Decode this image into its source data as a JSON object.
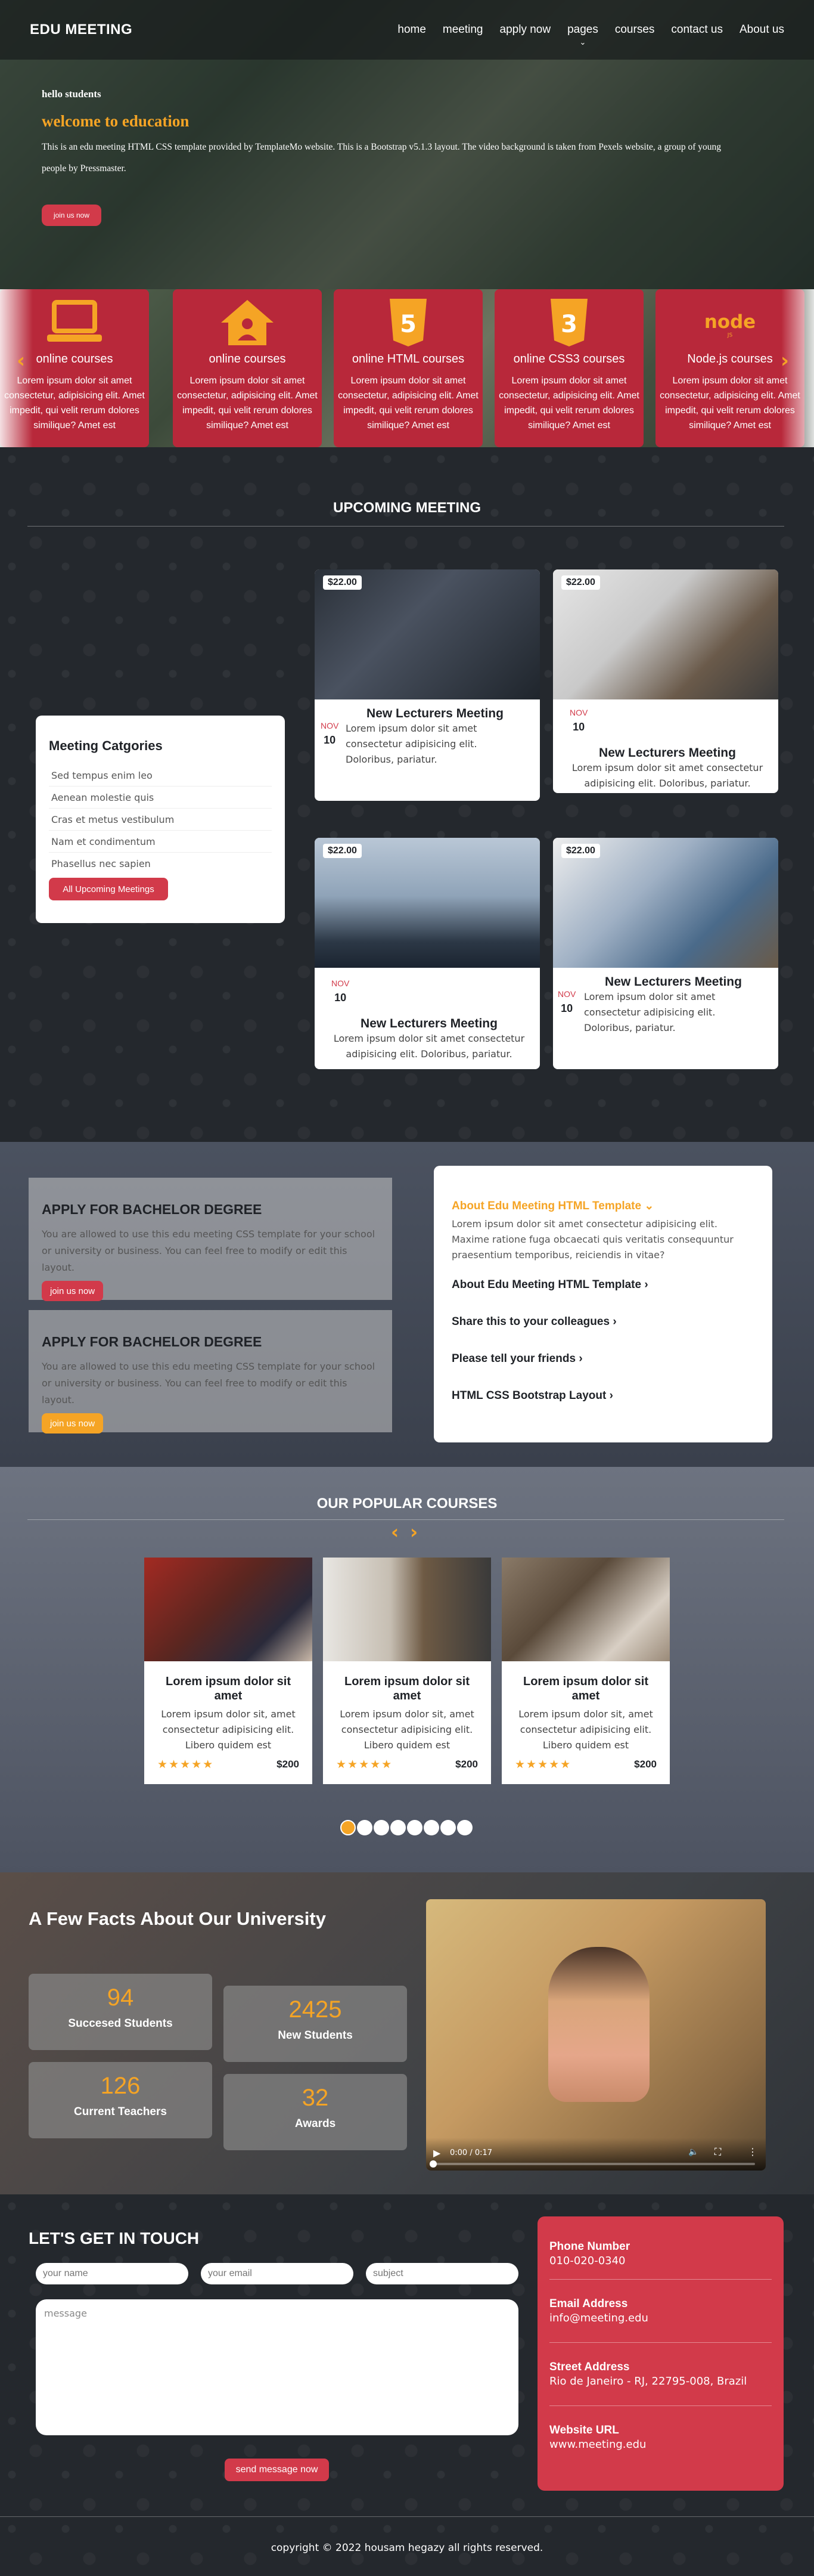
{
  "header": {
    "logo": "EDU MEETING",
    "nav": [
      "home",
      "meeting",
      "apply now",
      "pages",
      "courses",
      "contact us",
      "About us"
    ],
    "pages_chevron": "⌄"
  },
  "hero": {
    "greeting": "hello students",
    "headline": "welcome to education",
    "description": "This is an edu meeting HTML CSS template provided by TemplateMo website. This is a Bootstrap v5.1.3 layout. The video background is taken from Pexels website, a group of young people by Pressmaster.",
    "button": "join us now"
  },
  "courses_strip": {
    "items": [
      {
        "icon": "laptop-icon",
        "title": "online courses",
        "desc": "Lorem ipsum dolor sit amet consectetur, adipisicing elit. Amet impedit, qui velit rerum dolores similique? Amet est"
      },
      {
        "icon": "home-user-icon",
        "title": "online courses",
        "desc": "Lorem ipsum dolor sit amet consectetur, adipisicing elit. Amet impedit, qui velit rerum dolores similique? Amet est"
      },
      {
        "icon": "html5-icon",
        "title": "online HTML courses",
        "desc": "Lorem ipsum dolor sit amet consectetur, adipisicing elit. Amet impedit, qui velit rerum dolores similique? Amet est"
      },
      {
        "icon": "css3-icon",
        "title": "online CSS3 courses",
        "desc": "Lorem ipsum dolor sit amet consectetur, adipisicing elit. Amet impedit, qui velit rerum dolores similique? Amet est"
      },
      {
        "icon": "nodejs-icon",
        "title": "Node.js courses",
        "desc": "Lorem ipsum dolor sit amet consectetur, adipisicing elit. Amet impedit, qui velit rerum dolores similique? Amet est"
      }
    ],
    "prev": "‹",
    "next": "›",
    "accent": "#f5a425"
  },
  "upcoming": {
    "title": "UPCOMING MEETING",
    "categories": {
      "title": "Meeting Catgories",
      "items": [
        "Sed tempus enim leo",
        "Aenean molestie quis",
        "Cras et metus vestibulum",
        "Nam et condimentum",
        "Phasellus nec sapien"
      ],
      "button": "All Upcoming Meetings"
    },
    "meetings": [
      {
        "price": "$22.00",
        "month": "NOV",
        "day": "10",
        "title": "New Lecturers Meeting",
        "desc": "Lorem ipsum dolor sit amet consectetur adipisicing elit. Doloribus, pariatur."
      },
      {
        "price": "$22.00",
        "month": "NOV",
        "day": "10",
        "title": "New Lecturers Meeting",
        "desc": "Lorem ipsum dolor sit amet consectetur adipisicing elit. Doloribus, pariatur."
      },
      {
        "price": "$22.00",
        "month": "NOV",
        "day": "10",
        "title": "New Lecturers Meeting",
        "desc": "Lorem ipsum dolor sit amet consectetur adipisicing elit. Doloribus, pariatur."
      },
      {
        "price": "$22.00",
        "month": "NOV",
        "day": "10",
        "title": "New Lecturers Meeting",
        "desc": "Lorem ipsum dolor sit amet consectetur adipisicing elit. Doloribus, pariatur."
      }
    ]
  },
  "apply": {
    "boxes": [
      {
        "title": "APPLY FOR BACHELOR DEGREE",
        "desc": "You are allowed to use this edu meeting CSS template for your school or university or business. You can feel free to modify or edit this layout.",
        "button": "join us now"
      },
      {
        "title": "APPLY FOR BACHELOR DEGREE",
        "desc": "You are allowed to use this edu meeting CSS template for your school or university or business. You can feel free to modify or edit this layout.",
        "button": "join us now"
      }
    ],
    "faq": {
      "active_title": "About Edu Meeting HTML Template",
      "active_chevron": "⌄",
      "active_text": "Lorem ipsum dolor sit amet consectetur adipisicing elit. Maxime ratione fuga obcaecati quis veritatis consequuntur praesentium temporibus, reiciendis in vitae?",
      "items": [
        "About Edu Meeting HTML Template",
        "Share this to your colleagues",
        "Please tell your friends",
        "HTML CSS Bootstrap Layout"
      ],
      "chevron": "›"
    }
  },
  "popular": {
    "title": "OUR POPULAR COURSES",
    "prev": "‹",
    "next": "›",
    "cards": [
      {
        "title": "Lorem ipsum dolor sit amet",
        "desc": "Lorem ipsum dolor sit, amet consectetur adipisicing elit. Libero quidem est",
        "stars": "★★★★★",
        "price": "$200"
      },
      {
        "title": "Lorem ipsum dolor sit amet",
        "desc": "Lorem ipsum dolor sit, amet consectetur adipisicing elit. Libero quidem est",
        "stars": "★★★★★",
        "price": "$200"
      },
      {
        "title": "Lorem ipsum dolor sit amet",
        "desc": "Lorem ipsum dolor sit, amet consectetur adipisicing elit. Libero quidem est",
        "stars": "★★★★★",
        "price": "$200"
      }
    ],
    "dots": 8,
    "active_dot": 0
  },
  "facts": {
    "title": "A Few Facts About Our University",
    "items": [
      {
        "number": "94",
        "label": "Succesed Students"
      },
      {
        "number": "2425",
        "label": "New Students"
      },
      {
        "number": "126",
        "label": "Current Teachers"
      },
      {
        "number": "32",
        "label": "Awards"
      }
    ],
    "video_time": "0:00 / 0:17",
    "video_progress": 0.0
  },
  "contact": {
    "title": "LET'S GET IN TOUCH",
    "name_placeholder": "your name",
    "email_placeholder": "your email",
    "subject_placeholder": "subject",
    "message_placeholder": "message",
    "button": "send message now",
    "info": [
      {
        "label": "Phone Number",
        "value": "010-020-0340"
      },
      {
        "label": "Email Address",
        "value": "info@meeting.edu"
      },
      {
        "label": "Street Address",
        "value": "Rio de Janeiro - RJ, 22795-008, Brazil"
      },
      {
        "label": "Website URL",
        "value": "www.meeting.edu"
      }
    ]
  },
  "footer": {
    "copyright": "copyright © 2022 housam hegazy all rights reserved."
  },
  "colors": {
    "accent": "#f5a425",
    "red": "#d23a4a",
    "card_red": "#b8283a"
  }
}
